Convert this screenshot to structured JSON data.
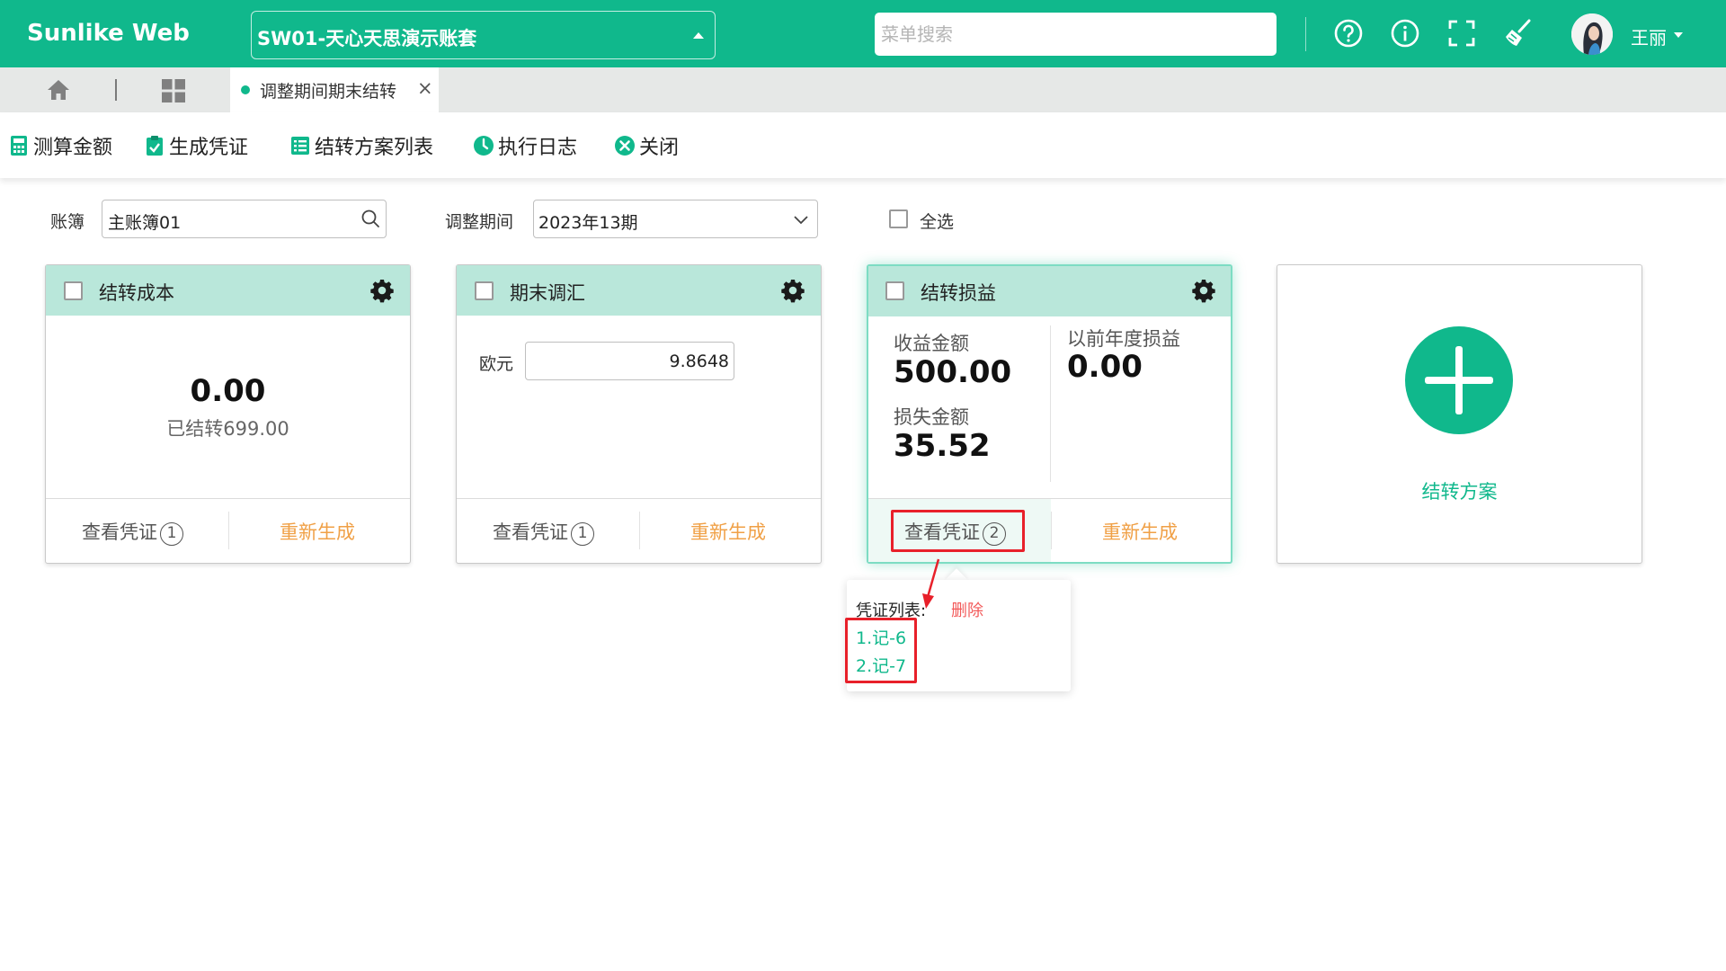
{
  "header": {
    "brand": "Sunlike Web",
    "ledger": "SW01-天心天思演示账套",
    "search_placeholder": "菜单搜索",
    "icons": [
      "help-icon",
      "info-icon",
      "fullscreen-icon",
      "clean-cache-icon"
    ],
    "user_name": "王丽",
    "accent_color": "#10b88c"
  },
  "tabs": {
    "active_label": "调整期间期末结转",
    "close_glyph": "×"
  },
  "toolbar": {
    "calc_amount": "测算金额",
    "generate_voucher": "生成凭证",
    "scheme_list": "结转方案列表",
    "execution_log": "执行日志",
    "close": "关闭"
  },
  "filters": {
    "book_label": "账簿",
    "book_value": "主账簿01",
    "period_label": "调整期间",
    "period_value": "2023年13期",
    "select_all_label": "全选"
  },
  "cards": [
    {
      "title": "结转成本",
      "amount": "0.00",
      "transferred": "已结转699.00",
      "view_label": "查看凭证",
      "voucher_count": "1",
      "regen_label": "重新生成"
    },
    {
      "title": "期末调汇",
      "currency_label": "欧元",
      "rate": "9.8648",
      "view_label": "查看凭证",
      "voucher_count": "1",
      "regen_label": "重新生成"
    },
    {
      "title": "结转损益",
      "income_label": "收益金额",
      "income_value": "500.00",
      "prior_label": "以前年度损益",
      "prior_value": "0.00",
      "loss_label": "损失金额",
      "loss_value": "35.52",
      "view_label": "查看凭证",
      "voucher_count": "2",
      "regen_label": "重新生成"
    }
  ],
  "add_card": {
    "label": "结转方案"
  },
  "popover": {
    "list_label": "凭证列表:",
    "delete_label": "删除",
    "items": [
      "1.记-6",
      "2.记-7"
    ]
  },
  "colors": {
    "card_header": "#b9e7da",
    "regen": "#f0a046",
    "delete": "#f25a5a",
    "annotation": "#e8202a"
  }
}
